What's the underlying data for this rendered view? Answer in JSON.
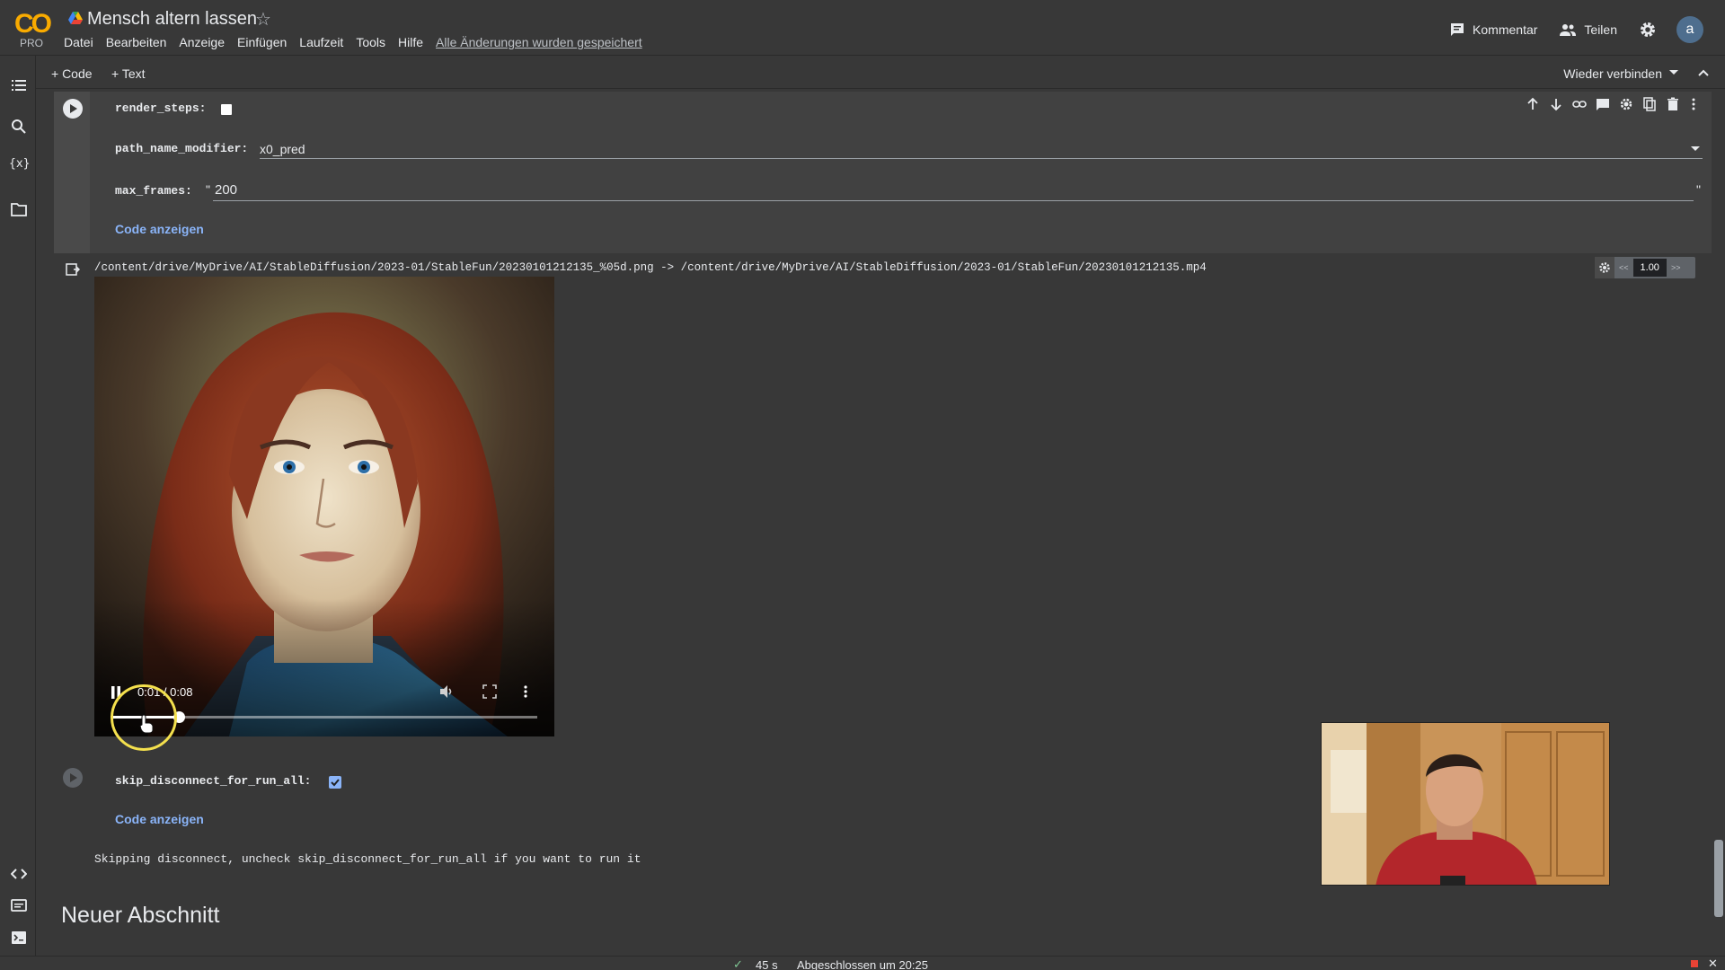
{
  "app": {
    "logo_text": "CO",
    "badge": "PRO",
    "doc_title": "Mensch altern lassen",
    "menu": [
      "Datei",
      "Bearbeiten",
      "Anzeige",
      "Einfügen",
      "Laufzeit",
      "Tools",
      "Hilfe"
    ],
    "saved_status": "Alle Änderungen wurden gespeichert",
    "comment_label": "Kommentar",
    "share_label": "Teilen",
    "avatar_initial": "a"
  },
  "toolbar": {
    "add_code": "+ Code",
    "add_text": "+ Text",
    "reconnect": "Wieder verbinden"
  },
  "cell1": {
    "render_steps_label": "render_steps:",
    "render_steps_checked": false,
    "path_name_modifier_label": "path_name_modifier:",
    "path_name_modifier_value": "x0_pred",
    "max_frames_label": "max_frames:",
    "max_frames_value": "200",
    "show_code": "Code anzeigen"
  },
  "output": {
    "path_text": "/content/drive/MyDrive/AI/StableDiffusion/2023-01/StableFun/20230101212135_%05d.png -> /content/drive/MyDrive/AI/StableDiffusion/2023-01/StableFun/20230101212135.mp4",
    "speed_value": "1.00",
    "speed_prev": "<<",
    "speed_next": ">>"
  },
  "video": {
    "time": "0:01 / 0:08",
    "progress": 0.16
  },
  "cell2": {
    "label": "skip_disconnect_for_run_all:",
    "checked": true,
    "show_code": "Code anzeigen",
    "output": "Skipping disconnect, uncheck skip_disconnect_for_run_all if you want to run it"
  },
  "section_heading": "Neuer Abschnitt",
  "status": {
    "duration": "45 s",
    "completed": "Abgeschlossen um 20:25"
  },
  "colors": {
    "accent": "#8ab4f8",
    "logo": "#f9ab00",
    "background": "#383838"
  }
}
